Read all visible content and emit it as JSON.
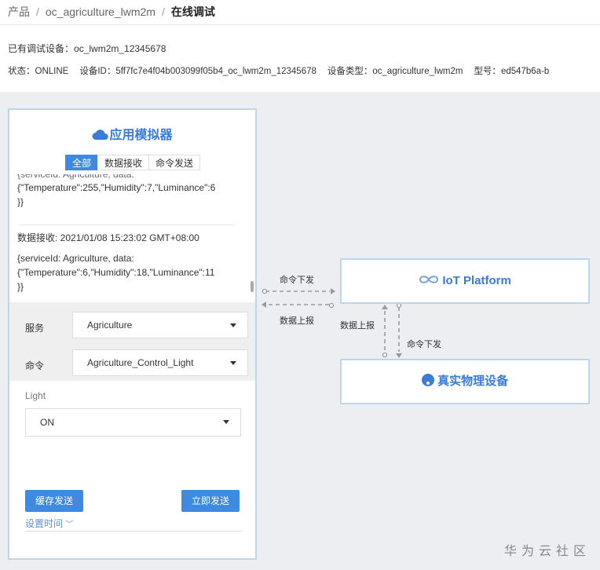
{
  "breadcrumb": {
    "items": [
      "产品",
      "oc_agriculture_lwm2m"
    ],
    "current": "在线调试"
  },
  "device": {
    "label": "已有调试设备：",
    "value": "oc_lwm2m_12345678"
  },
  "info": [
    {
      "label": "状态：",
      "value": "ONLINE"
    },
    {
      "label": "设备ID：",
      "value": "5ff7fc7e4f04b003099f05b4_oc_lwm2m_12345678"
    },
    {
      "label": "设备类型：",
      "value": "oc_agriculture_lwm2m"
    },
    {
      "label": "型号：",
      "value": "ed547b6a-b"
    }
  ],
  "simulator": {
    "title": "应用模拟器",
    "tabs": [
      "全部",
      "数据接收",
      "命令发送"
    ],
    "active_tab": 0,
    "log": [
      {
        "lines": [
          "{serviceId: Agriculture, data:",
          "{\"Temperature\":255,\"Humidity\":7,\"Luminance\":6",
          "}}"
        ]
      },
      {
        "header": "数据接收: 2021/01/08 15:23:02 GMT+08:00",
        "lines": [
          "{serviceId: Agriculture, data:",
          "{\"Temperature\":6,\"Humidity\":18,\"Luminance\":11",
          "}}"
        ]
      }
    ],
    "service_label": "服务",
    "service_value": "Agriculture",
    "command_label": "命令",
    "command_value": "Agriculture_Control_Light",
    "param_label": "Light",
    "param_value": "ON",
    "cache_send": "缓存发送",
    "send_now": "立即发送",
    "set_time": "设置时间"
  },
  "diagram": {
    "iot_platform": "IoT Platform",
    "device": "真实物理设备",
    "cmd_down": "命令下发",
    "data_up": "数据上报"
  },
  "watermark": "华为云社区",
  "colors": {
    "accent": "#3e8ae0",
    "border": "#bcd6ec"
  }
}
